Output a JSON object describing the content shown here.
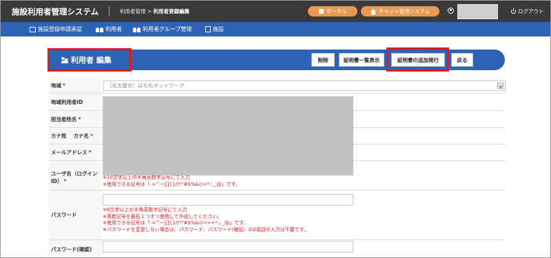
{
  "app": {
    "title": "施設利用者管理システム",
    "breadcrumb_parent": "利用者管理",
    "breadcrumb_sep": ">",
    "breadcrumb_current": "利用者登録編集",
    "portal_label": "ポータル",
    "chat_label": "チャット管理システム",
    "logout_label": "ログアウト"
  },
  "nav": {
    "items": [
      {
        "label": "施設登録申請承認",
        "icon": "edit-icon"
      },
      {
        "label": "利用者",
        "icon": "user-icon"
      },
      {
        "label": "利用者グループ管理",
        "icon": "group-icon"
      },
      {
        "label": "施設",
        "icon": "building-icon"
      }
    ]
  },
  "page": {
    "title": "利用者 編集",
    "buttons": {
      "delete": "削除",
      "cert_list": "証明書一覧表示",
      "cert_add": "証明書の追加発行",
      "back": "戻る"
    }
  },
  "form": {
    "region_label": "地域",
    "region_value": "［名古屋市］はち丸ネットワーク",
    "region_user_id_label": "地域利用者ID",
    "contact_name_label": "担当者姓名",
    "kana_label": "カナ姓　 カナ名",
    "email_label": "メールアドレス",
    "username_label": "ユーザ名（ログインID）",
    "username_notes": [
      "※10文字以上の半角英数字記号にて入力",
      "※使用できる記号は「-=^~|[]{}/?!\"#$%&()+*:;._@」です。"
    ],
    "password_label": "パスワード",
    "password_notes": [
      "※8文字以上の半角英数字記号にて入力",
      "※英数記号を最低１つずつ使用して作成してください。",
      "※使用できる記号は「-=^~|[]{}/?!\"#$%&()<>+*:;._@」です。",
      "※パスワードを変更しない場合は、パスワード、パスワード(確認）の2項目の入力は不要です。"
    ],
    "password_confirm_label": "パスワード(確認)",
    "required_mark": "*"
  }
}
